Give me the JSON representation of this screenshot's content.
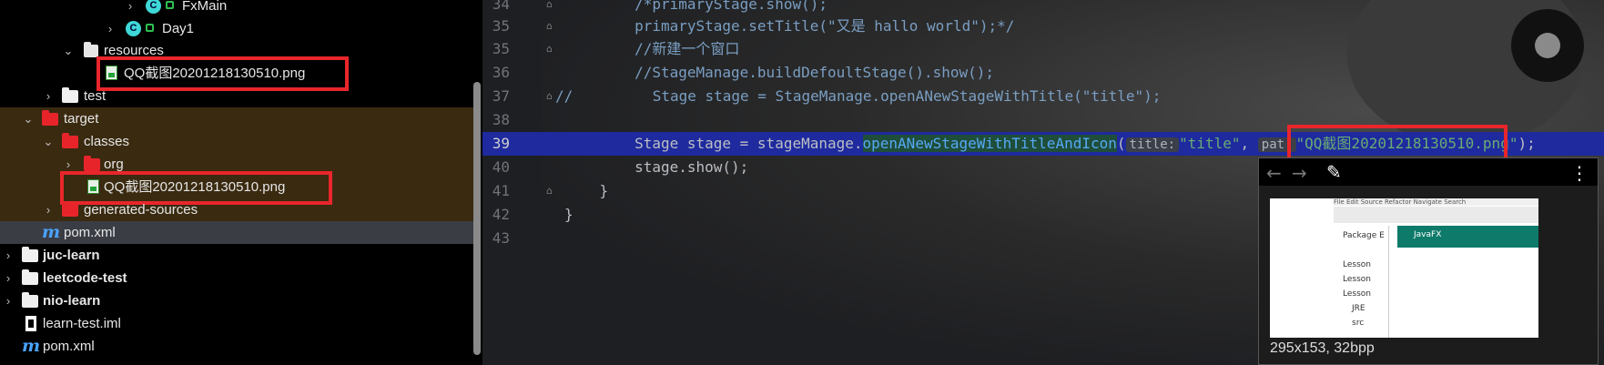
{
  "tree": {
    "items": [
      {
        "label": "FxMain"
      },
      {
        "label": "Day1"
      },
      {
        "label": "resources"
      },
      {
        "label": "QQ截图20201218130510.png"
      },
      {
        "label": "test"
      },
      {
        "label": "target"
      },
      {
        "label": "classes"
      },
      {
        "label": "org"
      },
      {
        "label": "QQ截图20201218130510.png"
      },
      {
        "label": "generated-sources"
      },
      {
        "label": "pom.xml"
      },
      {
        "label": "juc-learn"
      },
      {
        "label": "leetcode-test"
      },
      {
        "label": "nio-learn"
      },
      {
        "label": "learn-test.iml"
      },
      {
        "label": "pom.xml"
      }
    ],
    "highlight_color": "#e8262b",
    "folder_color": "#e8242b"
  },
  "editor": {
    "lines": [
      {
        "num": "34",
        "text": "        /*primaryStage.show();"
      },
      {
        "num": "35",
        "text": "        primaryStage.setTitle(\"又是 hallo world\");*/"
      },
      {
        "num": "35",
        "text": "        //新建一个窗口"
      },
      {
        "num": "36",
        "text": "        //StageManage.buildDefoultStage().show();"
      },
      {
        "num": "37",
        "prefix": "//",
        "text": "         Stage stage = StageManage.openANewStageWithTitle(\"title\");"
      },
      {
        "num": "38",
        "text": ""
      },
      {
        "num": "39",
        "part1": "        Stage stage = stageManage.",
        "method": "openANewStageWithTitleAndIcon",
        "paren": "(",
        "hint1": "title:",
        "arg1": "\"title\"",
        "comma": ", ",
        "hint2": "pat",
        "hint2_tail": ":",
        "arg2": "\"QQ截图20201218130510.png\"",
        "end": ");"
      },
      {
        "num": "40",
        "text": "        stage.show();"
      },
      {
        "num": "41",
        "text": "    }"
      },
      {
        "num": "42",
        "text": "}"
      },
      {
        "num": "43",
        "text": ""
      }
    ],
    "current_line": "39"
  },
  "popup": {
    "info": "295x153, 32bpp",
    "thumb": {
      "menu": "File  Edit  Source  Refactor  Navigate  Search",
      "package_title": "Package E",
      "items": [
        "Lesson",
        "Lesson",
        "Lesson",
        "JRE",
        "src"
      ],
      "window_title": "JavaFX"
    }
  }
}
